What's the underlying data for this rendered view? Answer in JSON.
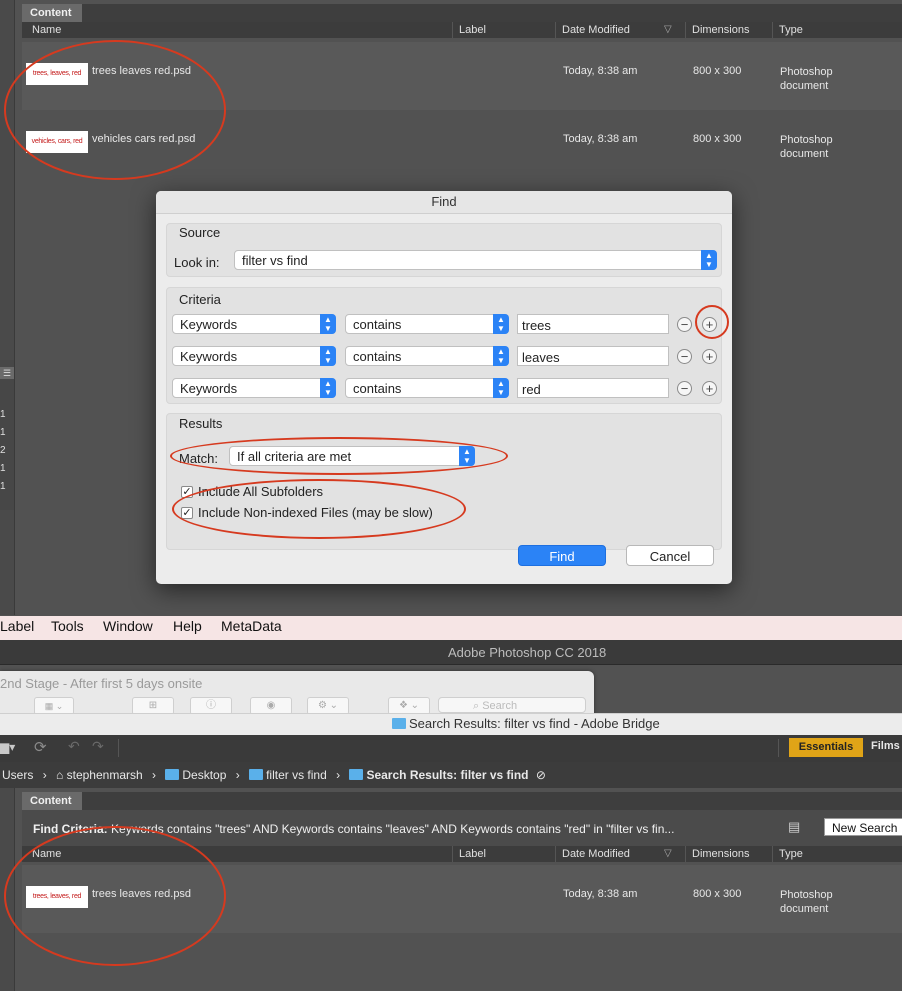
{
  "top_panel": {
    "tab_label": "Content",
    "columns": [
      "Name",
      "Label",
      "Date Modified",
      "Dimensions",
      "Type"
    ],
    "rows": [
      {
        "thumb": "trees, leaves, red",
        "name": "trees leaves red.psd",
        "date": "Today, 8:38 am",
        "dims": "800 x 300",
        "type_line1": "Photoshop",
        "type_line2": "document"
      },
      {
        "thumb": "vehicles, cars, red",
        "name": "vehicles cars red.psd",
        "date": "Today, 8:38 am",
        "dims": "800 x 300",
        "type_line1": "Photoshop",
        "type_line2": "document"
      }
    ],
    "left_edge_numbers": [
      "1",
      "1",
      "2",
      "1",
      "1"
    ]
  },
  "dialog": {
    "title": "Find",
    "source_heading": "Source",
    "look_in_label": "Look in:",
    "look_in_value": "filter vs find",
    "criteria_heading": "Criteria",
    "criteria": [
      {
        "field": "Keywords",
        "op": "contains",
        "value": "trees"
      },
      {
        "field": "Keywords",
        "op": "contains",
        "value": "leaves"
      },
      {
        "field": "Keywords",
        "op": "contains",
        "value": "red"
      }
    ],
    "results_heading": "Results",
    "match_label": "Match:",
    "match_value": "If all criteria are met",
    "subfolders_label": "Include All Subfolders",
    "nonindexed_label": "Include Non-indexed Files (may be slow)",
    "find_label": "Find",
    "cancel_label": "Cancel"
  },
  "menubar": {
    "items": [
      "Label",
      "Tools",
      "Window",
      "Help",
      "MetaData"
    ]
  },
  "photoshop_title": "Adobe Photoshop CC 2018",
  "finder": {
    "title": "2nd Stage - After first 5 days onsite",
    "search_placeholder": "Search"
  },
  "bridge": {
    "window_title": "Search Results: filter vs find - Adobe Bridge",
    "workspace_active": "Essentials",
    "workspace_next": "Films",
    "breadcrumb": [
      "Users",
      "stephenmarsh",
      "Desktop",
      "filter vs find",
      "Search Results: filter vs find"
    ],
    "tab_label": "Content",
    "find_criteria_label": "Find Criteria:",
    "find_criteria_text": "Keywords contains \"trees\" AND Keywords contains \"leaves\" AND Keywords contains \"red\" in \"filter vs fin...",
    "new_search_label": "New Search",
    "columns": [
      "Name",
      "Label",
      "Date Modified",
      "Dimensions",
      "Type"
    ],
    "rows": [
      {
        "thumb": "trees, leaves, red",
        "name": "trees leaves red.psd",
        "date": "Today, 8:38 am",
        "dims": "800 x 300",
        "type_line1": "Photoshop",
        "type_line2": "document"
      }
    ]
  },
  "colors": {
    "annotation": "#d63a1f",
    "accent": "#2b83f6",
    "workspace": "#e0a417"
  }
}
